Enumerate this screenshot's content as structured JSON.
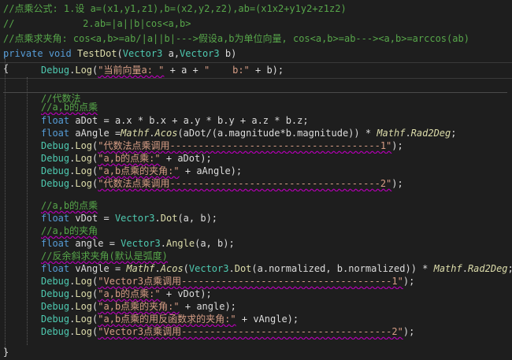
{
  "code": {
    "comment_formula": "//点乘公式: 1.设 a=(x1,y1,z1),b=(x2,y2,z2),ab=(x1x2+y1y2+z1z2)",
    "comment_formula2": "//            2.ab=|a||b|cos<a,b>",
    "comment_angle": "//点乘求夹角: cos<a,b>=ab/|a||b|--->假设a,b为单位向量, cos<a,b>=ab---><a,b>=arccos(ab)",
    "kw_private": "private",
    "kw_void": "void",
    "method_name": "TestDot",
    "type_vector3": "Vector3",
    "param_a": "a",
    "param_b": "b",
    "brace_open": "{",
    "brace_close": "}",
    "debug_class": "Debug",
    "debug_method": "Log",
    "kw_float": "float",
    "str_current_vector_a": "\"当前向量a: \"",
    "str_b": "\"    b:\"",
    "comment_algebra": "//代数法",
    "comment_ab_dot": "//a,b的点乘",
    "var_adot": "aDot",
    "var_aangle": "aAngle",
    "expr_adot": "a.x * b.x + a.y * b.y + a.z * b.z;",
    "mathf": "Mathf",
    "acos": "Acos",
    "expr_acos_args": "(aDot/(a.magnitude*b.magnitude)) * ",
    "rad2deg": "Rad2Deg",
    "str_alg_title1": "\"代数法点乘调用-------------------------------------1\"",
    "str_ab_dot": "\"a,b的点乘:\"",
    "str_ab_angle": "\"a,b点乘的夹角:\"",
    "str_alg_title2": "\"代数法点乘调用-------------------------------------2\"",
    "comment_ab_dot2": "//a,b的点乘",
    "var_vdot": "vDot",
    "dot_fn": "Dot",
    "comment_ab_angle": "//a,b的夹角",
    "var_angle": "angle",
    "angle_fn": "Angle",
    "comment_inverse": "//反余斜求夹角(默认是弧度)",
    "var_vangle": "vAngle",
    "expr_vangle_args": "(a.normalized, b.normalized)) * ",
    "str_v3_title1": "\"Vector3点乘调用-------------------------------------1\"",
    "str_ab_dot3": "\"a,b的点乘:\"",
    "str_ab_angle3": "\"a,b点乘的夹角:\"",
    "str_ab_inverse": "\"a,b点乘的用反函数求的夹角:\"",
    "str_v3_title2": "\"Vector3点乘调用-------------------------------------2\""
  }
}
